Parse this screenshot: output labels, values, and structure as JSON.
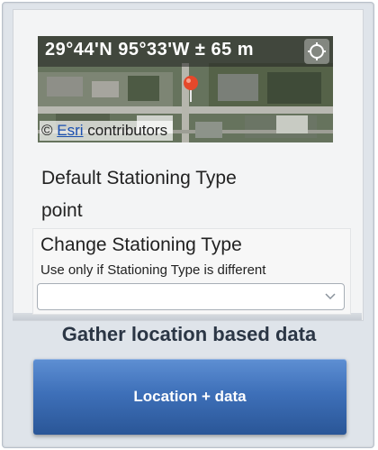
{
  "map": {
    "coordinates": "29°44'N 95°33'W ± 65 m",
    "attribution_prefix": "© ",
    "attribution_link": "Esri",
    "attribution_suffix": " contributors",
    "locate_icon": "crosshair-locate-icon",
    "pin_icon": "map-pin-icon",
    "pin_color": "#e5482b"
  },
  "form": {
    "default_label": "Default Stationing Type",
    "default_value": "point",
    "change_label": "Change Stationing Type",
    "change_hint": "Use only if Stationing Type is different",
    "change_select_value": "",
    "select_icon": "chevron-down-icon"
  },
  "heading": "Gather location based data",
  "cta_label": "Location + data",
  "colors": {
    "cta": "#3e70b9",
    "heading": "#2b3645",
    "link": "#1a4fb0"
  }
}
